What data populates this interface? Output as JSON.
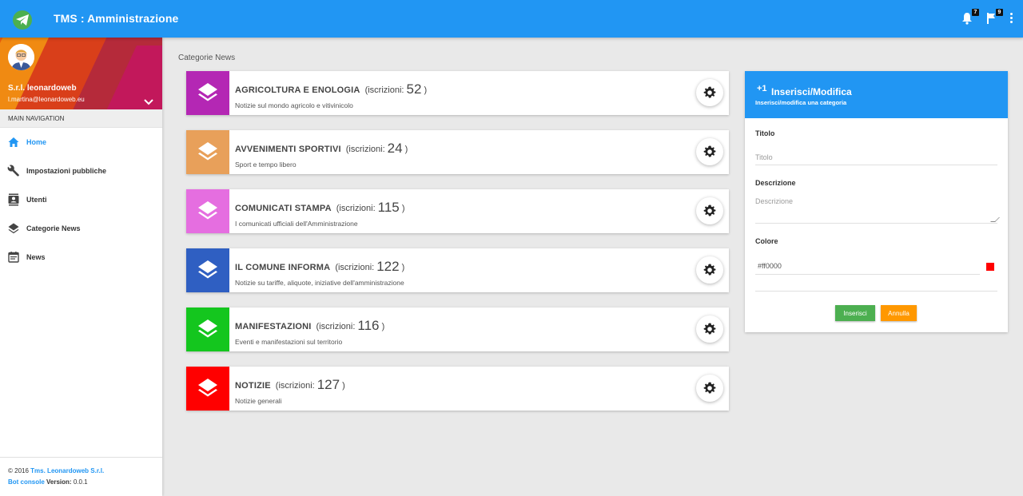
{
  "app": {
    "title": "TMS : Amministrazione",
    "notifications_count": "7",
    "flags_count": "9",
    "accent_color": "#2196f3"
  },
  "sidebar": {
    "user": {
      "name": "S.r.l. leonardoweb",
      "email": "l.martina@leonardoweb.eu"
    },
    "nav_header": "MAIN NAVIGATION",
    "items": [
      {
        "label": "Home",
        "icon": "home-icon",
        "active": true
      },
      {
        "label": "Impostazioni pubbliche",
        "icon": "wrench-icon"
      },
      {
        "label": "Utenti",
        "icon": "contacts-icon"
      },
      {
        "label": "Categorie News",
        "icon": "layers-icon"
      },
      {
        "label": "News",
        "icon": "calendar-icon"
      }
    ],
    "footer": {
      "copyright": "© 2016",
      "company": "Tms. Leonardoweb S.r.l.",
      "console": "Bot console",
      "version_label": "Version:",
      "version": "0.0.1"
    }
  },
  "breadcrumb": "Categorie News",
  "categories": [
    {
      "name": "AGRICOLTURA E ENOLOGIA",
      "subs_label": "(iscrizioni:",
      "count": "52",
      "close": ")",
      "description": "Notizie sul mondo agricolo e vitivinicolo",
      "color": "#b427b4"
    },
    {
      "name": "AVVENIMENTI SPORTIVI",
      "subs_label": "(iscrizioni:",
      "count": "24",
      "close": ")",
      "description": "Sport e tempo libero",
      "color": "#e8a05a"
    },
    {
      "name": "COMUNICATI STAMPA",
      "subs_label": "(iscrizioni:",
      "count": "115",
      "close": ")",
      "description": "I comunicati ufficiali dell'Amministrazione",
      "color": "#e56ee0"
    },
    {
      "name": "IL COMUNE INFORMA",
      "subs_label": "(iscrizioni:",
      "count": "122",
      "close": ")",
      "description": "Notizie su tariffe, aliquote, iniziative dell'amministrazione",
      "color": "#2f5fc2"
    },
    {
      "name": "MANIFESTAZIONI",
      "subs_label": "(iscrizioni:",
      "count": "116",
      "close": ")",
      "description": "Eventi e manifestazioni sul territorio",
      "color": "#14c61e"
    },
    {
      "name": "NOTIZIE",
      "subs_label": "(iscrizioni:",
      "count": "127",
      "close": ")",
      "description": "Notizie generali",
      "color": "#ff0000"
    }
  ],
  "form": {
    "plus": "+1",
    "title": "Inserisci/Modifica",
    "subtitle": "Inserisci/modifica una categoria",
    "titolo_label": "Titolo",
    "titolo_placeholder": "Titolo",
    "descrizione_label": "Descrizione",
    "descrizione_placeholder": "Descrizione",
    "colore_label": "Colore",
    "colore_value": "#ff0000",
    "insert_label": "Inserisci",
    "cancel_label": "Annulla",
    "insert_color": "#4caf50",
    "cancel_color": "#ff9800"
  }
}
